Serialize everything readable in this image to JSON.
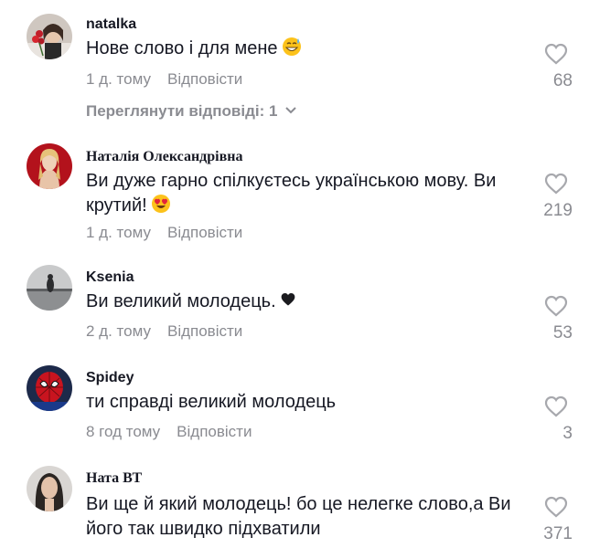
{
  "comments": [
    {
      "author": "natalka",
      "text": "Нове слово і для мене",
      "emoji": "grinning-sweat-emoji",
      "time": "1 д. тому",
      "reply_label": "Відповісти",
      "likes": "68",
      "view_replies": "Переглянути відповіді: 1"
    },
    {
      "author": "Наталія Олександрівна",
      "text": "Ви дуже гарно спілкуєтесь українською мову. Ви крутий!",
      "emoji": "heart-eyes-emoji",
      "time": "1 д. тому",
      "reply_label": "Відповісти",
      "likes": "219"
    },
    {
      "author": "Ksenia",
      "text": "Ви великий молодець.",
      "emoji": "black-heart-emoji",
      "time": "2 д. тому",
      "reply_label": "Відповісти",
      "likes": "53"
    },
    {
      "author": "Spidey",
      "text": "ти справді великий молодець",
      "time": "8 год тому",
      "reply_label": "Відповісти",
      "likes": "3"
    },
    {
      "author": "Ната ВТ",
      "text": "Ви ще й який молодець! бо це нелегке слово,а Ви його так швидко підхватили",
      "likes": "371"
    }
  ],
  "colors": {
    "text": "#161823",
    "muted": "#8a8b91",
    "icon": "#a7a8ad",
    "background": "#ffffff"
  }
}
